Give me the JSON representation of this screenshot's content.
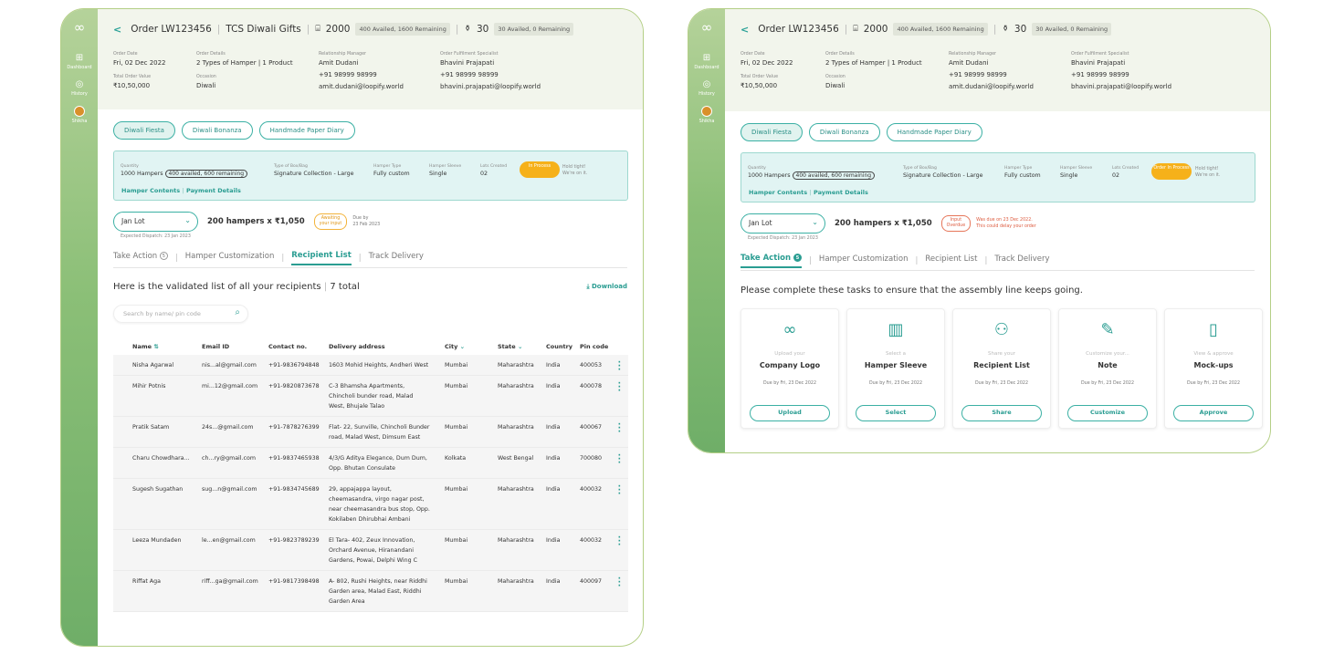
{
  "sidebar": {
    "items": [
      {
        "label": "Dashboard",
        "icon": "grid-icon"
      },
      {
        "label": "History",
        "icon": "history-icon"
      },
      {
        "label": "Shikha",
        "icon": "avatar"
      }
    ]
  },
  "colors": {
    "accent": "#2aa197",
    "sidebar_start": "#b5d29a",
    "sidebar_end": "#6fae68",
    "in_process": "#f6b11a",
    "overdue": "#dd5b3f"
  },
  "screen1": {
    "header": {
      "order_id": "Order LW123456",
      "client": "TCS Diwali Gifts",
      "hamper_count": "2000",
      "hamper_tag": "400 Availed, 1600 Remaining",
      "box_count": "30",
      "box_tag": "30 Availed, 0 Remaining"
    },
    "meta": {
      "order_date_label": "Order Date",
      "order_date": "Fri, 02 Dec 2022",
      "order_details_label": "Order Details",
      "order_details": "2 Types of Hamper | 1 Product",
      "rm_label": "Relationship Manager",
      "rm_name": "Amit Dudani",
      "rm_phone": "+91 98999 98999",
      "rm_email": "amit.dudani@loopify.world",
      "ofs_label": "Order Fulfilment Specialist",
      "ofs_name": "Bhavini Prajapati",
      "ofs_phone": "+91 98999 98999",
      "ofs_email": "bhavini.prajapati@loopify.world",
      "total_label": "Total Order Value",
      "total": "₹10,50,000",
      "occasion_label": "Occasion",
      "occasion": "Diwali"
    },
    "chips": [
      "Diwali Fiesta",
      "Diwali Bonanza",
      "Handmade Paper Diary"
    ],
    "info": {
      "quantity_label": "Quantity",
      "quantity": "1000 Hampers",
      "quantity_pill": "400 availed, 600 remaining",
      "box_type_label": "Type of Box/Bag",
      "box_type": "Signature Collection - Large",
      "hamper_type_label": "Hamper Type",
      "hamper_type": "Fully custom",
      "sleeve_label": "Hamper Sleeve",
      "sleeve": "Single",
      "lots_label": "Lots Created",
      "lots": "02",
      "status": "In Process",
      "hold_tight": "Hold tight!",
      "hold_sub": "We're on it.",
      "link_contents": "Hamper Contents",
      "link_payment": "Payment Details"
    },
    "lot": {
      "selected": "Jan Lot",
      "expected_dispatch": "Expected Dispatch: 23 Jan 2023",
      "hampers_line": "200 hampers x ₹1,050",
      "badge_line1": "Awaiting",
      "badge_line2": "your input",
      "due_label": "Due by",
      "due_date": "23 Feb 2023"
    },
    "tabs": [
      {
        "label": "Take Action",
        "count": "5"
      },
      {
        "label": "Hamper Customization"
      },
      {
        "label": "Recipient List"
      },
      {
        "label": "Track Delivery"
      }
    ],
    "list_heading": "Here is the validated list of all your recipients",
    "list_total": "7 total",
    "download": "Download",
    "search_placeholder": "Search by name/ pin code",
    "columns": [
      "Name",
      "Email ID",
      "Contact no.",
      "Delivery address",
      "City",
      "State",
      "Country",
      "Pin code"
    ],
    "rows": [
      {
        "name": "Nisha Agarwal",
        "email": "nis...al@gmail.com",
        "phone": "+91-9836794848",
        "address": [
          "1603 Mohid Heights, Andheri West"
        ],
        "city": "Mumbai",
        "state": "Maharashtra",
        "country": "India",
        "pin": "400053"
      },
      {
        "name": "Mihir Potnis",
        "email": "mi...12@gmail.com",
        "phone": "+91-9820873678",
        "address": [
          "C-3 Bhamsha Apartments,",
          "Chincholi bunder road, Malad",
          "West, Bhujale Talao"
        ],
        "city": "Mumbai",
        "state": "Maharashtra",
        "country": "India",
        "pin": "400078"
      },
      {
        "name": "Pratik Satam",
        "email": "24s...@gmail.com",
        "phone": "+91-7878276399",
        "address": [
          "Flat- 22, Sunville, Chincholi Bunder",
          "road, Malad West, Dimsum East"
        ],
        "city": "Mumbai",
        "state": "Maharashtra",
        "country": "India",
        "pin": "400067"
      },
      {
        "name": "Charu Chowdhara...",
        "email": "ch...ry@gmail.com",
        "phone": "+91-9837465938",
        "address": [
          "4/3/G Aditya Elegance, Dum Dum,",
          "Opp. Bhutan Consulate"
        ],
        "city": "Kolkata",
        "state": "West Bengal",
        "country": "India",
        "pin": "700080"
      },
      {
        "name": "Sugesh Sugathan",
        "email": "sug...n@gmail.com",
        "phone": "+91-9834745689",
        "address": [
          "29, appajappa layout,",
          "cheemasandra, virgo nagar post,",
          "near cheemasandra bus stop, Opp.",
          "Kokilaben Dhirubhai Ambani"
        ],
        "city": "Mumbai",
        "state": "Maharashtra",
        "country": "India",
        "pin": "400032"
      },
      {
        "name": "Leeza Mundaden",
        "email": "le...en@gmail.com",
        "phone": "+91-9823789239",
        "address": [
          "El Tara- 402, Zeux Innovation,",
          "Orchard Avenue, Hiranandani",
          "Gardens, Powai, Delphi Wing C"
        ],
        "city": "Mumbai",
        "state": "Maharashtra",
        "country": "India",
        "pin": "400032"
      },
      {
        "name": "Riffat Aga",
        "email": "riff...ga@gmail.com",
        "phone": "+91-9817398498",
        "address": [
          "A- 802, Rushi Heights, near Riddhi",
          "Garden area, Malad East, Riddhi",
          "Garden Area"
        ],
        "city": "Mumbai",
        "state": "Maharashtra",
        "country": "India",
        "pin": "400097"
      }
    ]
  },
  "screen2": {
    "header": {
      "order_id": "Order LW123456",
      "hamper_count": "2000",
      "hamper_tag": "400 Availed, 1600 Remaining",
      "box_count": "30",
      "box_tag": "30 Availed, 0 Remaining"
    },
    "status": "Order In Process",
    "lot": {
      "badge_line1": "Input",
      "badge_line2": "Overdue",
      "overdue_line1": "Was due on 23 Dec 2022.",
      "overdue_line2": "This could delay your order"
    },
    "tasks_heading": "Please complete these tasks to ensure that the assembly line keeps going.",
    "cards": [
      {
        "icon": "infinity-icon",
        "glyph": "∞",
        "sub": "Upload your",
        "title": "Company Logo",
        "due": "Due by Fri, 23 Dec 2022",
        "button": "Upload"
      },
      {
        "icon": "sleeve-icon",
        "glyph": "▥",
        "sub": "Select a",
        "title": "Hamper Sleeve",
        "due": "Due by Fri, 23 Dec 2022",
        "button": "Select"
      },
      {
        "icon": "people-icon",
        "glyph": "⚇",
        "sub": "Share your",
        "title": "Recipient List",
        "due": "Due by Fri, 23 Dec 2022",
        "button": "Share"
      },
      {
        "icon": "note-icon",
        "glyph": "✎",
        "sub": "Customize your...",
        "title": "Note",
        "due": "Due by Fri, 23 Dec 2022",
        "button": "Customize"
      },
      {
        "icon": "mockup-icon",
        "glyph": "▯",
        "sub": "View & approve",
        "title": "Mock-ups",
        "due": "Due by Fri, 23 Dec 2022",
        "button": "Approve"
      }
    ]
  }
}
